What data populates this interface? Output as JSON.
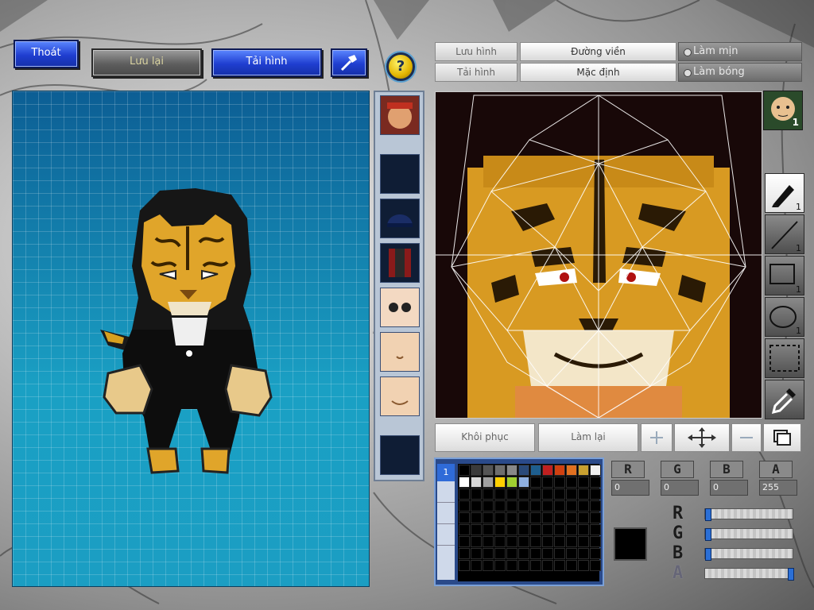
{
  "toolbar": {
    "exit_label": "Thoát",
    "save_label": "Lưu lại",
    "reload_label": "Tải hình",
    "help_label": "?"
  },
  "preview_tabs": {
    "save_image": "Lưu hình",
    "outline": "Đường viền",
    "smooth": "Làm mịn",
    "load_image": "Tải hình",
    "default": "Mặc định",
    "shade": "Làm bóng"
  },
  "tools": {
    "badge": "1",
    "pencil_count": "1",
    "line_count": "1",
    "rect_count": "1",
    "ellipse_count": "1"
  },
  "actions": {
    "restore": "Khôi phục",
    "redo": "Làm lại"
  },
  "color_channels": {
    "r_label": "R",
    "g_label": "G",
    "b_label": "B",
    "a_label": "A",
    "r_value": "0",
    "g_value": "0",
    "b_value": "0",
    "a_value": "255",
    "r_level": 0,
    "g_level": 0,
    "b_level": 0,
    "a_level": 1.0,
    "current_color": "#000000"
  },
  "palette": {
    "layer_label": "1",
    "swatches": [
      "#000000",
      "#3a3a3a",
      "#555555",
      "#6e6e6e",
      "#888888",
      "#2a4a7a",
      "#1e5e8e",
      "#c02020",
      "#d04010",
      "#e07020",
      "#c8a030",
      "#f0f0f0",
      "#ffffff",
      "#d8d8d8",
      "#a0a0a0",
      "#ffd000",
      "#a0d030",
      "#8fb0e0"
    ]
  }
}
